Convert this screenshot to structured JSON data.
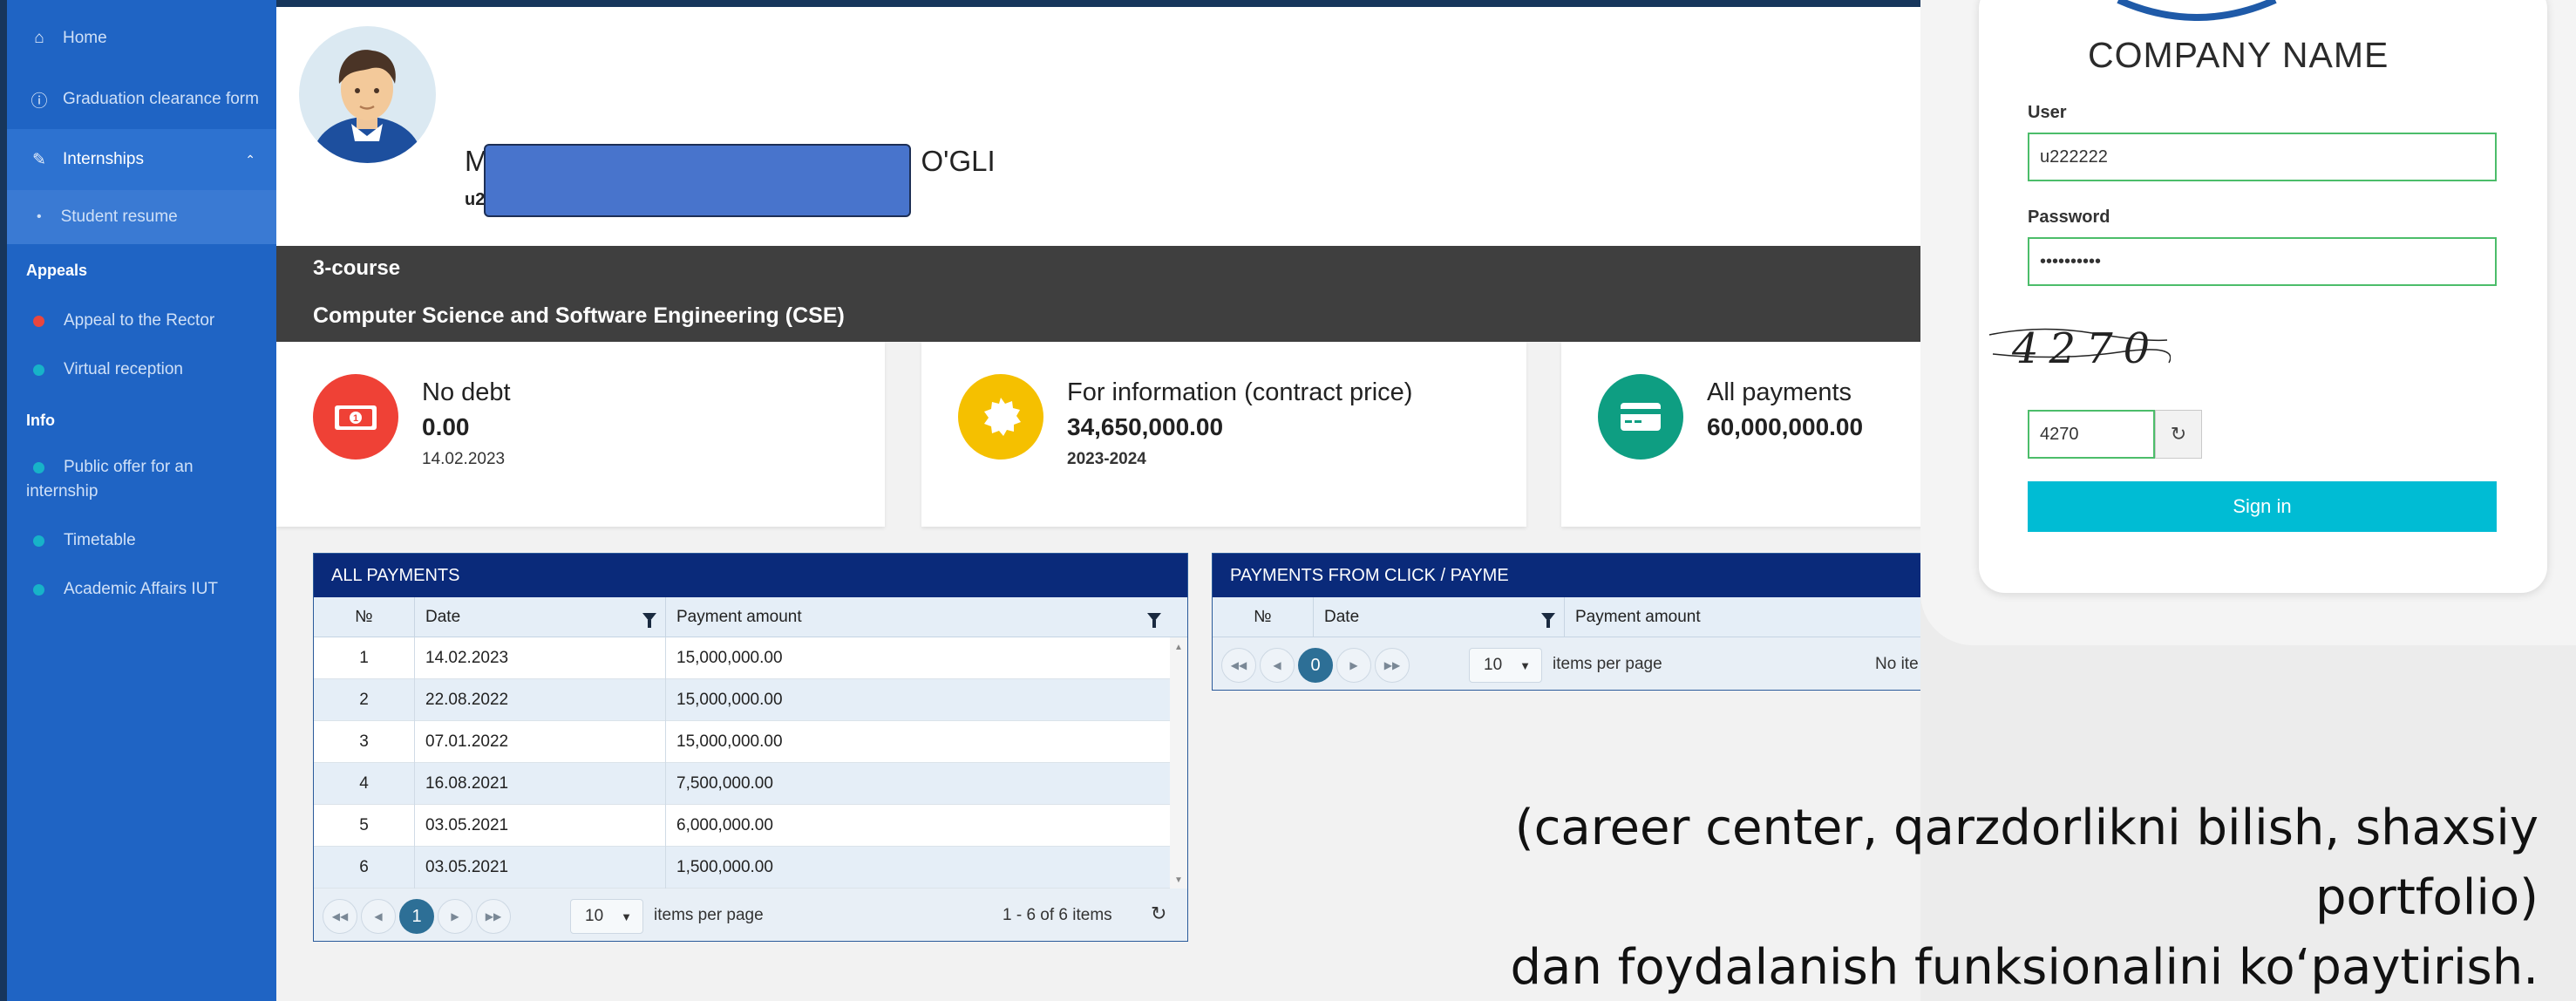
{
  "sidebar": {
    "home": "Home",
    "graduation": "Graduation clearance form",
    "internships": "Internships",
    "resume": "Student resume",
    "appeals_title": "Appeals",
    "appeal_rector": "Appeal to the Rector",
    "virtual_reception": "Virtual reception",
    "info_title": "Info",
    "public_offer": "Public offer for an internship",
    "timetable": "Timetable",
    "academic": "Academic Affairs IUT",
    "colors": {
      "red_dot": "#e9463e",
      "teal_dot": "#17b3c8"
    }
  },
  "profile": {
    "name_start": "M",
    "name_end": "O'GLI",
    "id_start": "u2"
  },
  "course": {
    "year": "3-course",
    "program": "Computer Science and Software Engineering (CSE)"
  },
  "cards": [
    {
      "title": "No debt",
      "value": "0.00",
      "sub": "14.02.2023",
      "color": "#ef4136",
      "icon": "banknote-icon"
    },
    {
      "title": "For information (contract price)",
      "value": "34,650,000.00",
      "sub": "2023-2024",
      "color": "#f5c000",
      "icon": "seal-icon"
    },
    {
      "title": "All payments",
      "value": "60,000,000.00",
      "sub": "",
      "color": "#0e9e82",
      "icon": "credit-card-icon"
    }
  ],
  "all_payments": {
    "title": "ALL PAYMENTS",
    "columns": [
      "№",
      "Date",
      "Payment amount"
    ],
    "rows": [
      [
        "1",
        "14.02.2023",
        "15,000,000.00"
      ],
      [
        "2",
        "22.08.2022",
        "15,000,000.00"
      ],
      [
        "3",
        "07.01.2022",
        "15,000,000.00"
      ],
      [
        "4",
        "16.08.2021",
        "7,500,000.00"
      ],
      [
        "5",
        "03.05.2021",
        "6,000,000.00"
      ],
      [
        "6",
        "03.05.2021",
        "1,500,000.00"
      ]
    ],
    "page": "1",
    "page_size": "10",
    "items_per_page": "items per page",
    "summary": "1 - 6 of 6 items"
  },
  "click_payments": {
    "title": "PAYMENTS FROM CLICK / PAYME",
    "columns": [
      "№",
      "Date",
      "Payment amount"
    ],
    "page": "0",
    "page_size": "10",
    "items_per_page": "items per page",
    "summary": "No ite"
  },
  "login": {
    "company": "COMPANY NAME",
    "user_label": "User",
    "user_value": "u222222",
    "password_label": "Password",
    "password_value": "••••••••••",
    "captcha_text": "4270",
    "captcha_value": "4270",
    "signin": "Sign in"
  },
  "caption": {
    "line1": "(career center, qarzdorlikni bilish, shaxsiy portfolio)",
    "line2": "dan foydalanish funksionalini ko‘paytirish."
  }
}
